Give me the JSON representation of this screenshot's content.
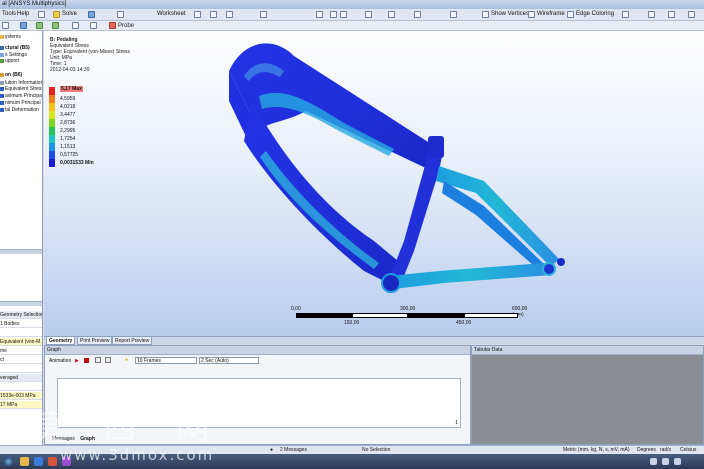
{
  "window": {
    "title": "al [ANSYS Multiphysics]"
  },
  "menu": {
    "tools": "Tools",
    "help": "Help"
  },
  "toolbar": {
    "solve": "Solve",
    "worksheet": "Worksheet",
    "probe": "Probe",
    "show_vertices": "Show Vertices",
    "wireframe": "Wireframe",
    "edge_coloring": "Edge Coloring"
  },
  "tree": {
    "items": [
      {
        "label": "ystems",
        "bold": false
      },
      {
        "label": "ctural (B5)",
        "bold": true
      },
      {
        "label": "s Settings",
        "bold": false
      },
      {
        "label": "upport",
        "bold": false
      },
      {
        "label": "on (B6)",
        "bold": true
      },
      {
        "label": "lution Information",
        "bold": false
      },
      {
        "label": "Equivalent Stress",
        "bold": false
      },
      {
        "label": "aximum Principal St",
        "bold": false
      },
      {
        "label": "nimum Principal Str",
        "bold": false
      },
      {
        "label": "tal Deformation",
        "bold": false
      }
    ]
  },
  "details": {
    "rows": [
      {
        "label": "Geometry Selection",
        "style": "hdr"
      },
      {
        "label": "1 Bodies",
        "style": ""
      },
      {
        "label": "",
        "style": ""
      },
      {
        "label": "Equivalent (von-M...",
        "style": "hl"
      },
      {
        "label": "me",
        "style": ""
      },
      {
        "label": "ct",
        "style": ""
      },
      {
        "label": "",
        "style": ""
      },
      {
        "label": "veraged",
        "style": "hdr"
      },
      {
        "label": "",
        "style": ""
      },
      {
        "label": "1533e-003 MPa",
        "style": "hl"
      },
      {
        "label": "17 MPa",
        "style": "hl"
      }
    ]
  },
  "viewport": {
    "title": "B: Pedaling",
    "line1": "Equivalent Stress",
    "line2": "Type: Equivalent (von-Mises) Stress",
    "line3": "Unit: MPa",
    "line4": "Time: 1",
    "line5": "2012-04-03 14:39"
  },
  "legend": {
    "entries": [
      {
        "label": "5,17 Max",
        "color": "#e0231c",
        "kind": "max"
      },
      {
        "label": "4,5959",
        "color": "#ef7d1c",
        "kind": ""
      },
      {
        "label": "4,0218",
        "color": "#f5c21a",
        "kind": ""
      },
      {
        "label": "3,4477",
        "color": "#d6e81e",
        "kind": ""
      },
      {
        "label": "2,8736",
        "color": "#7ed321",
        "kind": ""
      },
      {
        "label": "2,2995",
        "color": "#26c35a",
        "kind": ""
      },
      {
        "label": "1,7254",
        "color": "#1ec6c2",
        "kind": ""
      },
      {
        "label": "1,1513",
        "color": "#1d93e8",
        "kind": ""
      },
      {
        "label": "0,57725",
        "color": "#1d4fe0",
        "kind": ""
      },
      {
        "label": "0,0031533 Min",
        "color": "#1a1ad0",
        "kind": "min"
      }
    ]
  },
  "scale": {
    "t0": "0,00",
    "t1": "300,00",
    "t2": "600,00 (mm)",
    "t3": "150,00",
    "t4": "450,00"
  },
  "tabs": {
    "geometry": "Geometry",
    "print_preview": "Print Preview",
    "report_preview": "Report Preview"
  },
  "graph": {
    "title": "Graph",
    "animation": "Animation",
    "frames": "10 Frames",
    "duration": "2 Sec (Auto)",
    "corner": "1"
  },
  "tabular": {
    "title": "Tabular Data"
  },
  "bottom_tabs": {
    "messages": "Messages",
    "graph": "Graph"
  },
  "status": {
    "messages": "2 Messages",
    "selection": "No Selection",
    "units": "Metric (mm, kg, N, s, mV, mA)",
    "degrees": "Degrees",
    "rads": "rad/s",
    "temp": "Celsius"
  },
  "watermark": {
    "main": "莫 西 网",
    "sub": "www.3dmox.com"
  }
}
